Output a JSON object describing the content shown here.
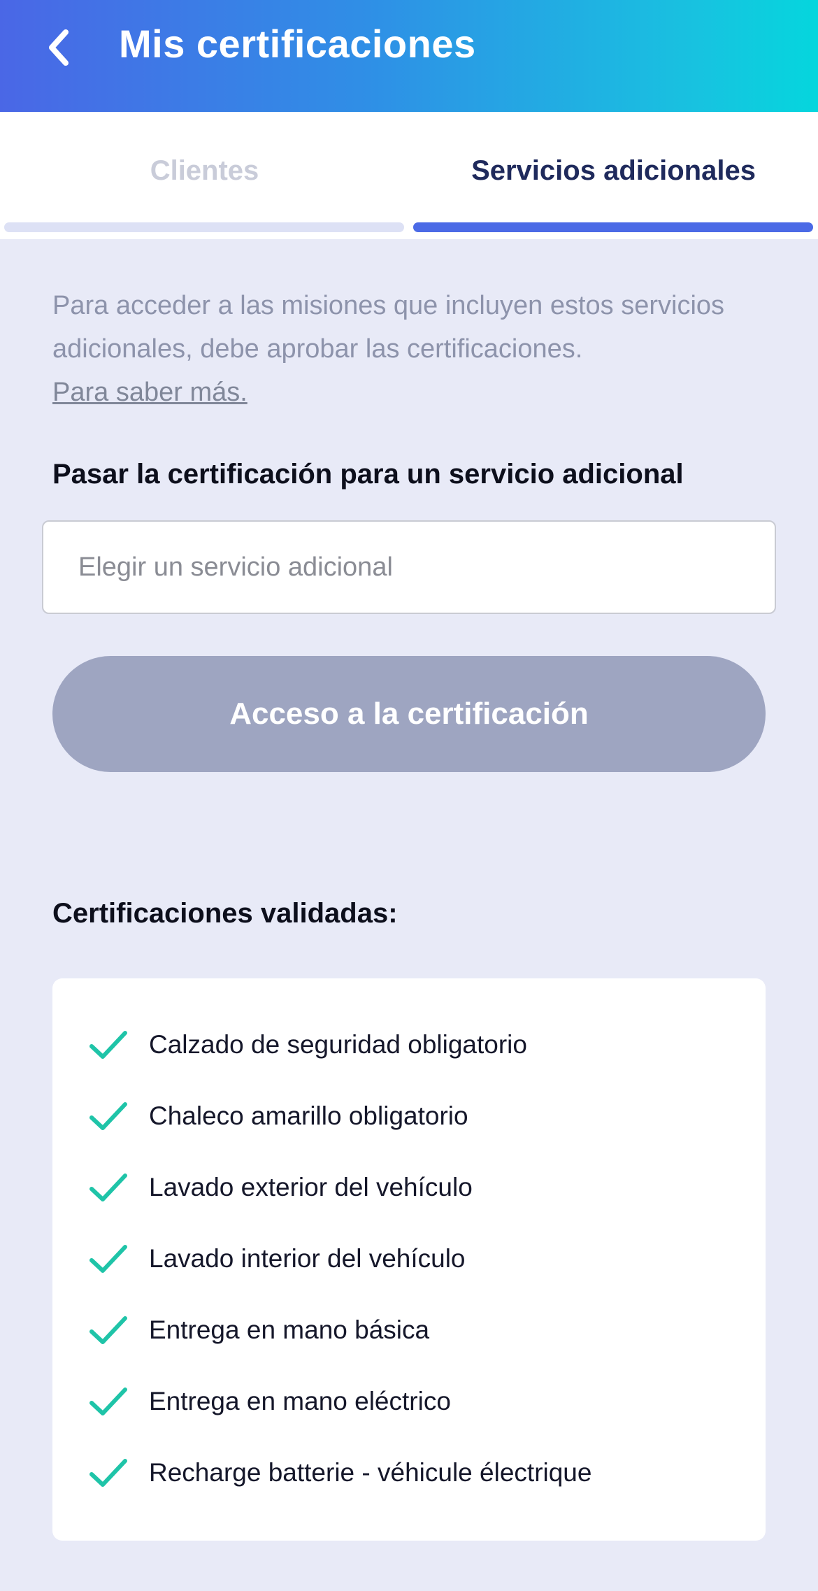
{
  "header": {
    "title": "Mis certificaciones",
    "back_icon": "chevron-left-icon"
  },
  "tabs": [
    {
      "label": "Clientes",
      "active": false
    },
    {
      "label": "Servicios adicionales",
      "active": true
    }
  ],
  "intro": {
    "text": "Para acceder a las misiones que incluyen estos servicios adicionales, debe aprobar las certificaciones.",
    "link": "Para saber más."
  },
  "certification_form": {
    "label": "Pasar la certificación para un servicio adicional",
    "select_placeholder": "Elegir un servicio adicional",
    "button_label": "Acceso a la certificación"
  },
  "validated": {
    "label": "Certificaciones validadas:",
    "items": [
      "Calzado de seguridad obligatorio",
      "Chaleco amarillo obligatorio",
      "Lavado exterior del vehículo",
      "Lavado interior del vehículo",
      "Entrega en mano básica",
      "Entrega en mano eléctrico",
      "Recharge batterie - véhicule électrique"
    ]
  },
  "colors": {
    "header_start": "#4a67e6",
    "header_end": "#05d6dd",
    "active_tab_text": "#1f2a5c",
    "active_tab_underline": "#4b6ae6",
    "check": "#1fc4a8",
    "button_disabled": "#9ea5c1",
    "background": "#e8eaf7"
  }
}
